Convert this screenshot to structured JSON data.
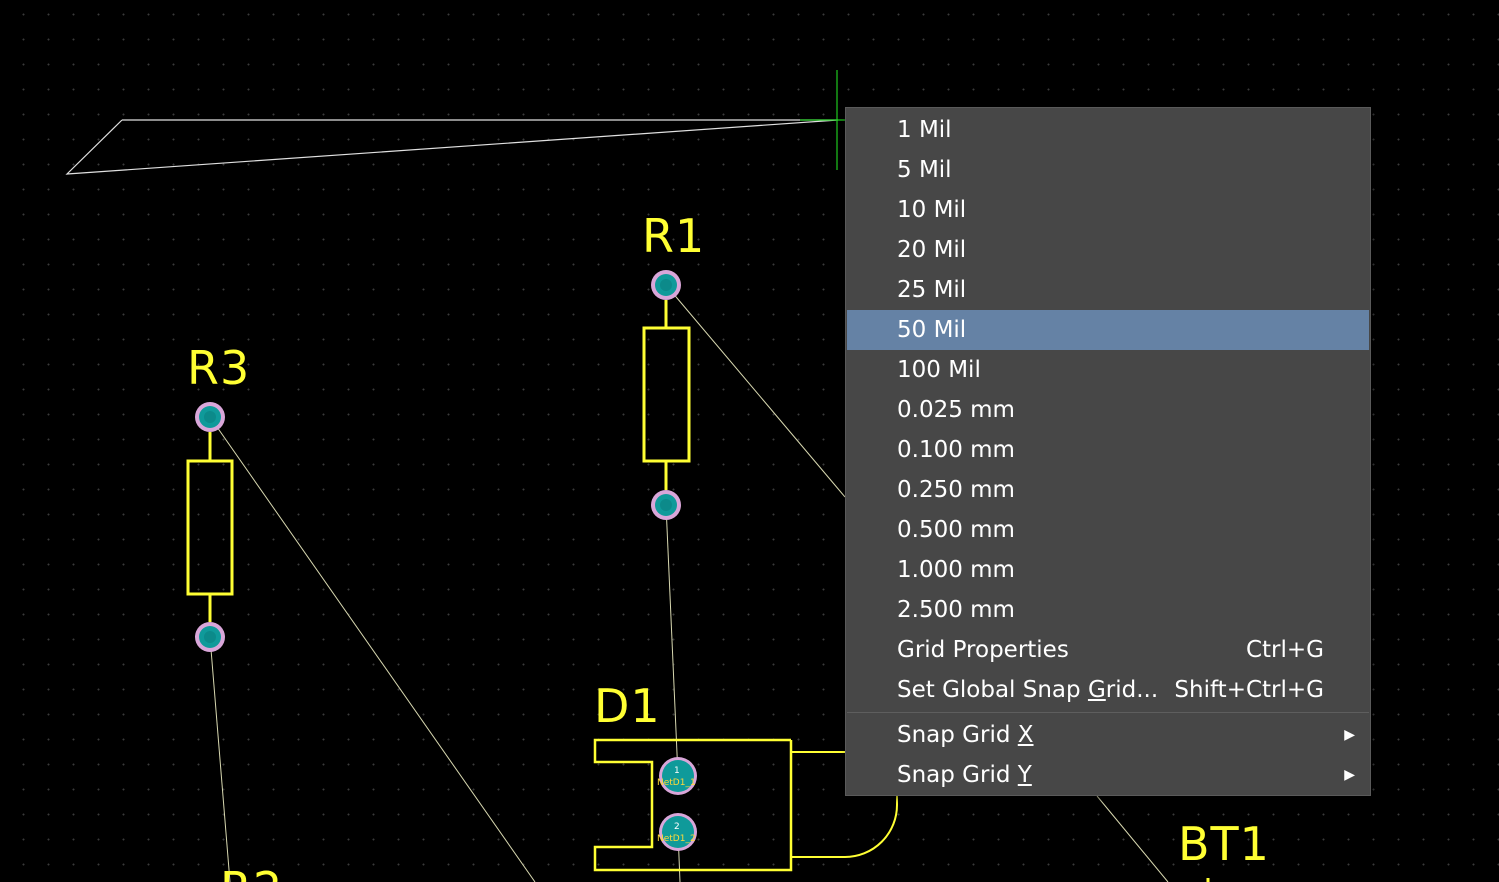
{
  "canvas": {
    "background": "#000000",
    "silkscreen_color": "#ffff33",
    "ratsnest_color": "#d8d8b0",
    "pad_fill_color": "#0f9a9a",
    "pad_ring_color": "#d9a6d9",
    "cursor_color": "#1ec81e",
    "references": {
      "r1": "R1",
      "r3": "R3",
      "d1": "D1",
      "bt1": "BT1",
      "r2_partial": "R2"
    },
    "d1_pads": {
      "pad1_number": "1",
      "pad1_net": "NetD1_1",
      "pad2_number": "2",
      "pad2_net": "NetD1_2"
    }
  },
  "context_menu": {
    "items": [
      {
        "label": "1 Mil"
      },
      {
        "label": "5 Mil"
      },
      {
        "label": "10 Mil"
      },
      {
        "label": "20 Mil"
      },
      {
        "label": "25 Mil"
      },
      {
        "label": "50 Mil",
        "selected": true
      },
      {
        "label": "100 Mil"
      },
      {
        "label": "0.025 mm"
      },
      {
        "label": "0.100 mm"
      },
      {
        "label": "0.250 mm"
      },
      {
        "label": "0.500 mm"
      },
      {
        "label": "1.000 mm"
      },
      {
        "label": "2.500 mm"
      }
    ],
    "grid_properties": {
      "label": "Grid Properties",
      "shortcut": "Ctrl+G"
    },
    "set_global_snap_grid": {
      "label_before": "Set Global Snap ",
      "label_mnemonic": "G",
      "label_after": "rid...",
      "shortcut": "Shift+Ctrl+G"
    },
    "snap_grid_x": {
      "label_before": "Snap Grid ",
      "label_mnemonic": "X",
      "arrow": "▶"
    },
    "snap_grid_y": {
      "label_before": "Snap Grid ",
      "label_mnemonic": "Y",
      "arrow": "▶"
    },
    "selected_bg": "#6582a5",
    "bg": "#474747"
  }
}
